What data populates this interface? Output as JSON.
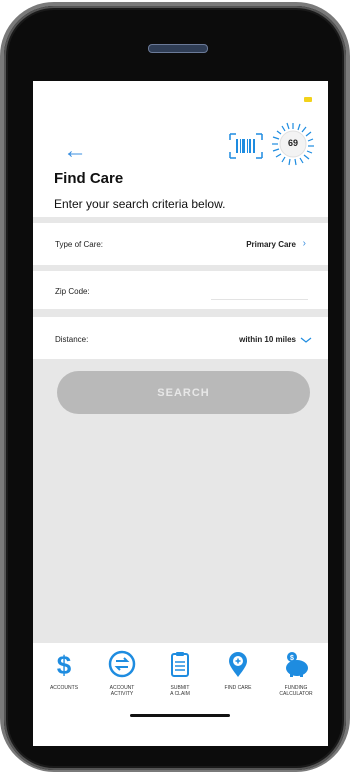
{
  "header": {
    "title": "Find Care",
    "subtitle": "Enter your search criteria below.",
    "score": "69"
  },
  "form": {
    "type_of_care_label": "Type of Care:",
    "type_of_care_value": "Primary Care",
    "zip_code_label": "Zip Code:",
    "zip_code_value": "",
    "distance_label": "Distance:",
    "distance_value": "within 10 miles"
  },
  "search_button": "SEARCH",
  "tabs": [
    {
      "label": "ACCOUNTS",
      "icon": "dollar-icon"
    },
    {
      "label": "ACCOUNT\nACTIVITY",
      "icon": "transfer-icon"
    },
    {
      "label": "SUBMIT\nA CLAIM",
      "icon": "clipboard-icon"
    },
    {
      "label": "FIND CARE",
      "icon": "location-pin-icon"
    },
    {
      "label": "FUNDING\nCALCULATOR",
      "icon": "piggy-bank-icon"
    }
  ],
  "colors": {
    "accent": "#1e8ce0",
    "background": "#e7e7e7",
    "button_disabled": "#b9b9b9",
    "battery": "#f2d21b"
  }
}
